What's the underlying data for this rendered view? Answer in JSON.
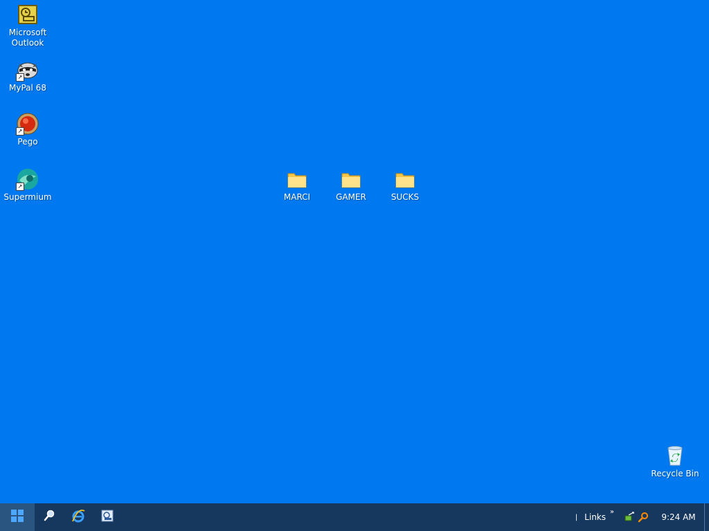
{
  "desktop": {
    "background": "#0078f0",
    "icons_left": [
      {
        "label": "Microsoft Outlook",
        "icon": "outlook-icon"
      },
      {
        "label": "MyPal 68",
        "icon": "mypal-icon"
      },
      {
        "label": "Pego",
        "icon": "pego-icon"
      },
      {
        "label": "Supermium",
        "icon": "supermium-icon"
      }
    ],
    "folders": [
      {
        "label": "MARCI",
        "icon": "folder-icon"
      },
      {
        "label": "GAMER",
        "icon": "folder-icon"
      },
      {
        "label": "SUCKS",
        "icon": "folder-icon"
      }
    ],
    "recycle_bin": {
      "label": "Recycle Bin",
      "icon": "recycle-bin-icon"
    }
  },
  "taskbar": {
    "background": "#16375e",
    "quick_launch": [
      "search-icon",
      "internet-explorer-icon",
      "outlook-quick-icon"
    ],
    "links_label": "Links",
    "links_chevron": "»",
    "tray_icons": [
      "network-icon",
      "search-tray-icon"
    ],
    "clock": "9:24 AM"
  }
}
